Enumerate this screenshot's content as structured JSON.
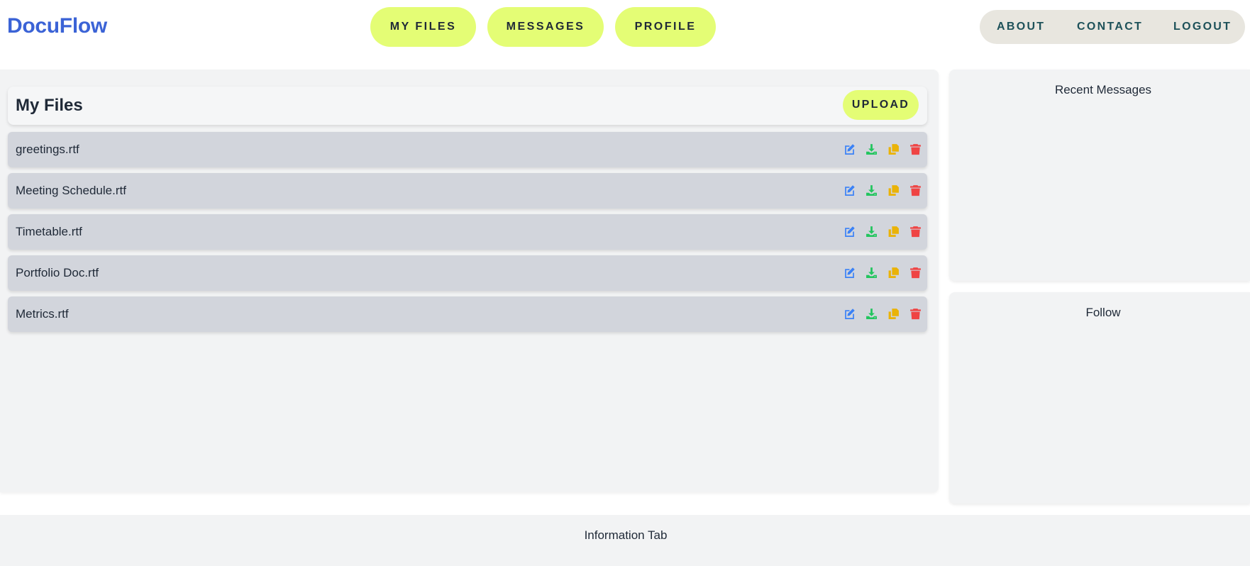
{
  "app": {
    "logo": "DocuFlow"
  },
  "main_nav": [
    {
      "label": "MY FILES"
    },
    {
      "label": "MESSAGES"
    },
    {
      "label": "PROFILE"
    }
  ],
  "aux_nav": [
    {
      "label": "ABOUT"
    },
    {
      "label": "CONTACT"
    },
    {
      "label": "LOGOUT"
    }
  ],
  "files": {
    "title": "My Files",
    "upload_label": "UPLOAD",
    "items": [
      {
        "name": "greetings.rtf"
      },
      {
        "name": "Meeting Schedule.rtf"
      },
      {
        "name": "Timetable.rtf"
      },
      {
        "name": "Portfolio Doc.rtf"
      },
      {
        "name": "Metrics.rtf"
      }
    ],
    "actions": [
      {
        "icon": "edit-icon",
        "color": "#3b82f6"
      },
      {
        "icon": "download-icon",
        "color": "#22c55e"
      },
      {
        "icon": "copy-icon",
        "color": "#eab308"
      },
      {
        "icon": "trash-icon",
        "color": "#ef4444"
      }
    ]
  },
  "sidebar": {
    "recent_messages_title": "Recent Messages",
    "follow_title": "Follow"
  },
  "footer": {
    "text": "Information Tab"
  },
  "colors": {
    "brand": "#3b63d6",
    "pill": "#e4fd75",
    "aux_text": "#1d5159"
  }
}
